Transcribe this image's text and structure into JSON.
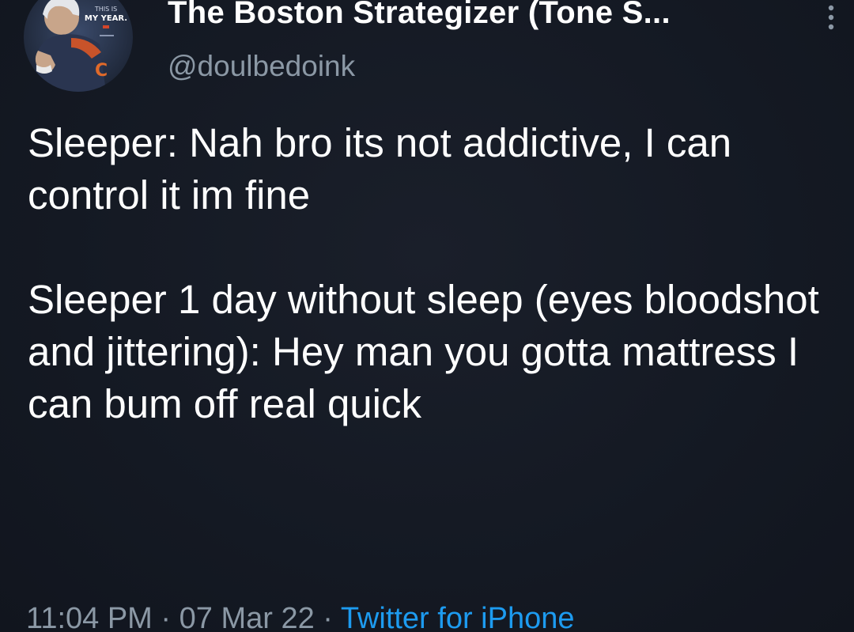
{
  "tweet": {
    "avatar": {
      "poster_text_line1": "THIS IS",
      "poster_text_line2": "MY YEAR."
    },
    "display_name": "The Boston Strategizer (Tone S...",
    "handle": "@doulbedoink",
    "body": [
      "Sleeper: Nah bro its not addictive, I can control it im fine",
      "Sleeper 1 day without sleep (eyes bloodshot and jittering): Hey man you gotta mattress I can bum off real quick"
    ],
    "time": "11:04 PM",
    "separator": "·",
    "date": "07 Mar 22",
    "source": "Twitter for iPhone"
  },
  "icons": {
    "more": "vertical-dots-icon"
  },
  "colors": {
    "background": "#151a24",
    "text_primary": "#ffffff",
    "text_secondary": "#8b98a5",
    "link": "#1d9bf0"
  }
}
